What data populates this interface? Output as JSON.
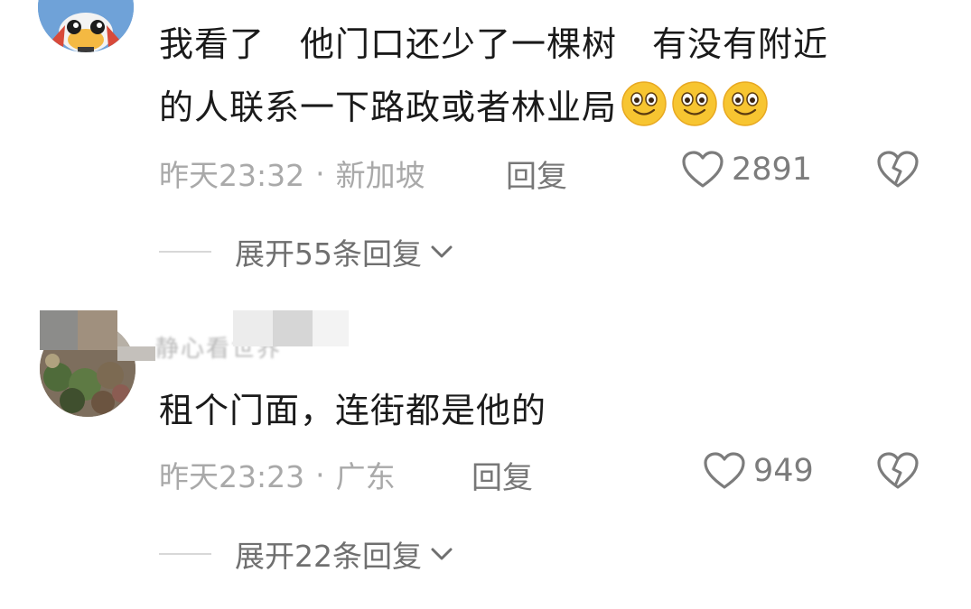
{
  "comments": [
    {
      "text_line1": "我看了　他门口还少了一棵树　有没有附近",
      "text_line2": "的人联系一下路政或者林业局",
      "emoji_count": 3,
      "time": "昨天23:32",
      "separator": "·",
      "location": "新加坡",
      "reply_label": "回复",
      "like_count": "2891",
      "expand_label": "展开55条回复"
    },
    {
      "username": "静心看世界",
      "text": "租个门面，连街都是他的",
      "time": "昨天23:23",
      "separator": "·",
      "location": "广东",
      "reply_label": "回复",
      "like_count": "949",
      "expand_label": "展开22条回复"
    }
  ],
  "icons": {
    "like": "heart-outline-icon",
    "dislike": "broken-heart-icon",
    "expand": "chevron-down-icon",
    "emoji": "smiling-face-emoji"
  },
  "colors": {
    "text_primary": "#1a1a1a",
    "text_meta": "#a9a9a9",
    "text_action": "#777777",
    "emoji_yellow": "#f7c531"
  }
}
